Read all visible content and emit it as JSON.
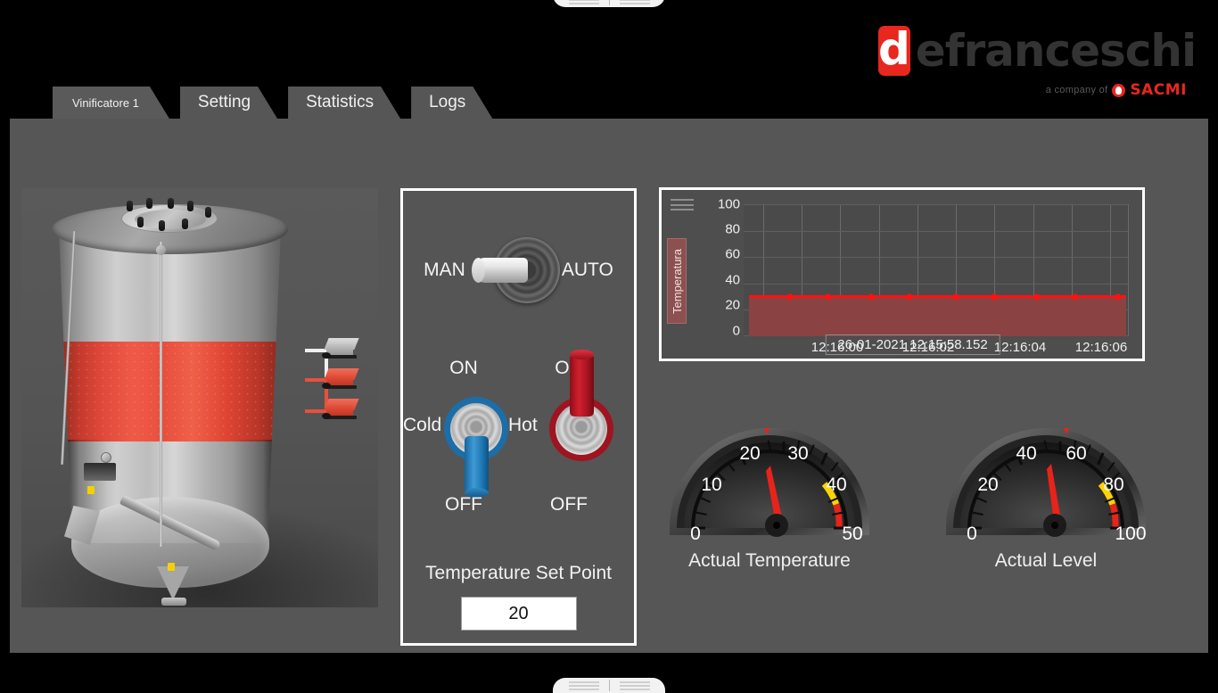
{
  "brand": {
    "logo_letter": "d",
    "logo_word": "efranceschi",
    "tagline": "a company of",
    "parent": "SACMI",
    "accent_red": "#e8271f",
    "logo_word_color": "#333333"
  },
  "tabs": [
    {
      "label": "Vinificatore 1",
      "active": true
    },
    {
      "label": "Setting",
      "active": false
    },
    {
      "label": "Statistics",
      "active": false
    },
    {
      "label": "Logs",
      "active": false
    }
  ],
  "tank": {
    "name": "vinificatore-tank",
    "band_color": "#e8503e",
    "body_color": "#c0c0c0"
  },
  "panel": {
    "mode_switch": {
      "left_label": "MAN",
      "right_label": "AUTO",
      "position": "MAN"
    },
    "cold": {
      "name": "Cold",
      "on_label": "ON",
      "off_label": "OFF",
      "state": "OFF",
      "color": "#1b6ea8"
    },
    "hot": {
      "name": "Hot",
      "on_label": "ON",
      "off_label": "OFF",
      "state": "ON",
      "color": "#9e1420"
    },
    "setpoint": {
      "label": "Temperature Set Point",
      "value": "20",
      "placeholder": "20"
    }
  },
  "chart_data": {
    "type": "line",
    "title": "",
    "ylabel": "Temperatura",
    "xlabel": "",
    "ylim": [
      0,
      100
    ],
    "yticks": [
      0,
      20,
      40,
      60,
      80,
      100
    ],
    "ytick_labels": [
      "0",
      "20",
      "40",
      "60",
      "80",
      "100"
    ],
    "xtick_labels": [
      "12:16:00",
      "12:16:02",
      "12:16:04",
      "12:16:06"
    ],
    "x": [
      "12:15:58",
      "12:15:59",
      "12:16:00",
      "12:16:01",
      "12:16:02",
      "12:16:03",
      "12:16:04",
      "12:16:05",
      "12:16:06",
      "12:16:07"
    ],
    "series": [
      {
        "name": "Temperatura",
        "values": [
          20,
          20,
          20,
          20,
          20,
          20,
          20,
          20,
          20,
          20
        ],
        "color": "#ff1111",
        "fill_color": "#8a4342"
      }
    ],
    "grid": true,
    "legend": false,
    "timestamp": "26-01-2021   12:15:58.152"
  },
  "gauges": [
    {
      "id": "actual-temperature",
      "caption": "Actual Temperature",
      "min": 0,
      "max": 50,
      "value": 22,
      "ticks": [
        0,
        10,
        20,
        30,
        40,
        50
      ],
      "tick_labels": [
        "0",
        "10",
        "20",
        "30",
        "40",
        "50"
      ],
      "warn_start": 35,
      "warn_end": 40,
      "alarm_start": 40,
      "alarm_end": 50,
      "needle_color": "#e8231a",
      "warn_color": "#ffd400",
      "alarm_color": "#e8231a"
    },
    {
      "id": "actual-level",
      "caption": "Actual Level",
      "min": 0,
      "max": 100,
      "value": 58,
      "ticks": [
        0,
        20,
        40,
        60,
        80,
        100
      ],
      "tick_labels": [
        "0",
        "20",
        "40",
        "60",
        "80",
        "100"
      ],
      "warn_start": 70,
      "warn_end": 80,
      "alarm_start": 80,
      "alarm_end": 100,
      "needle_color": "#e8231a",
      "warn_color": "#ffd400",
      "alarm_color": "#e8231a"
    }
  ]
}
